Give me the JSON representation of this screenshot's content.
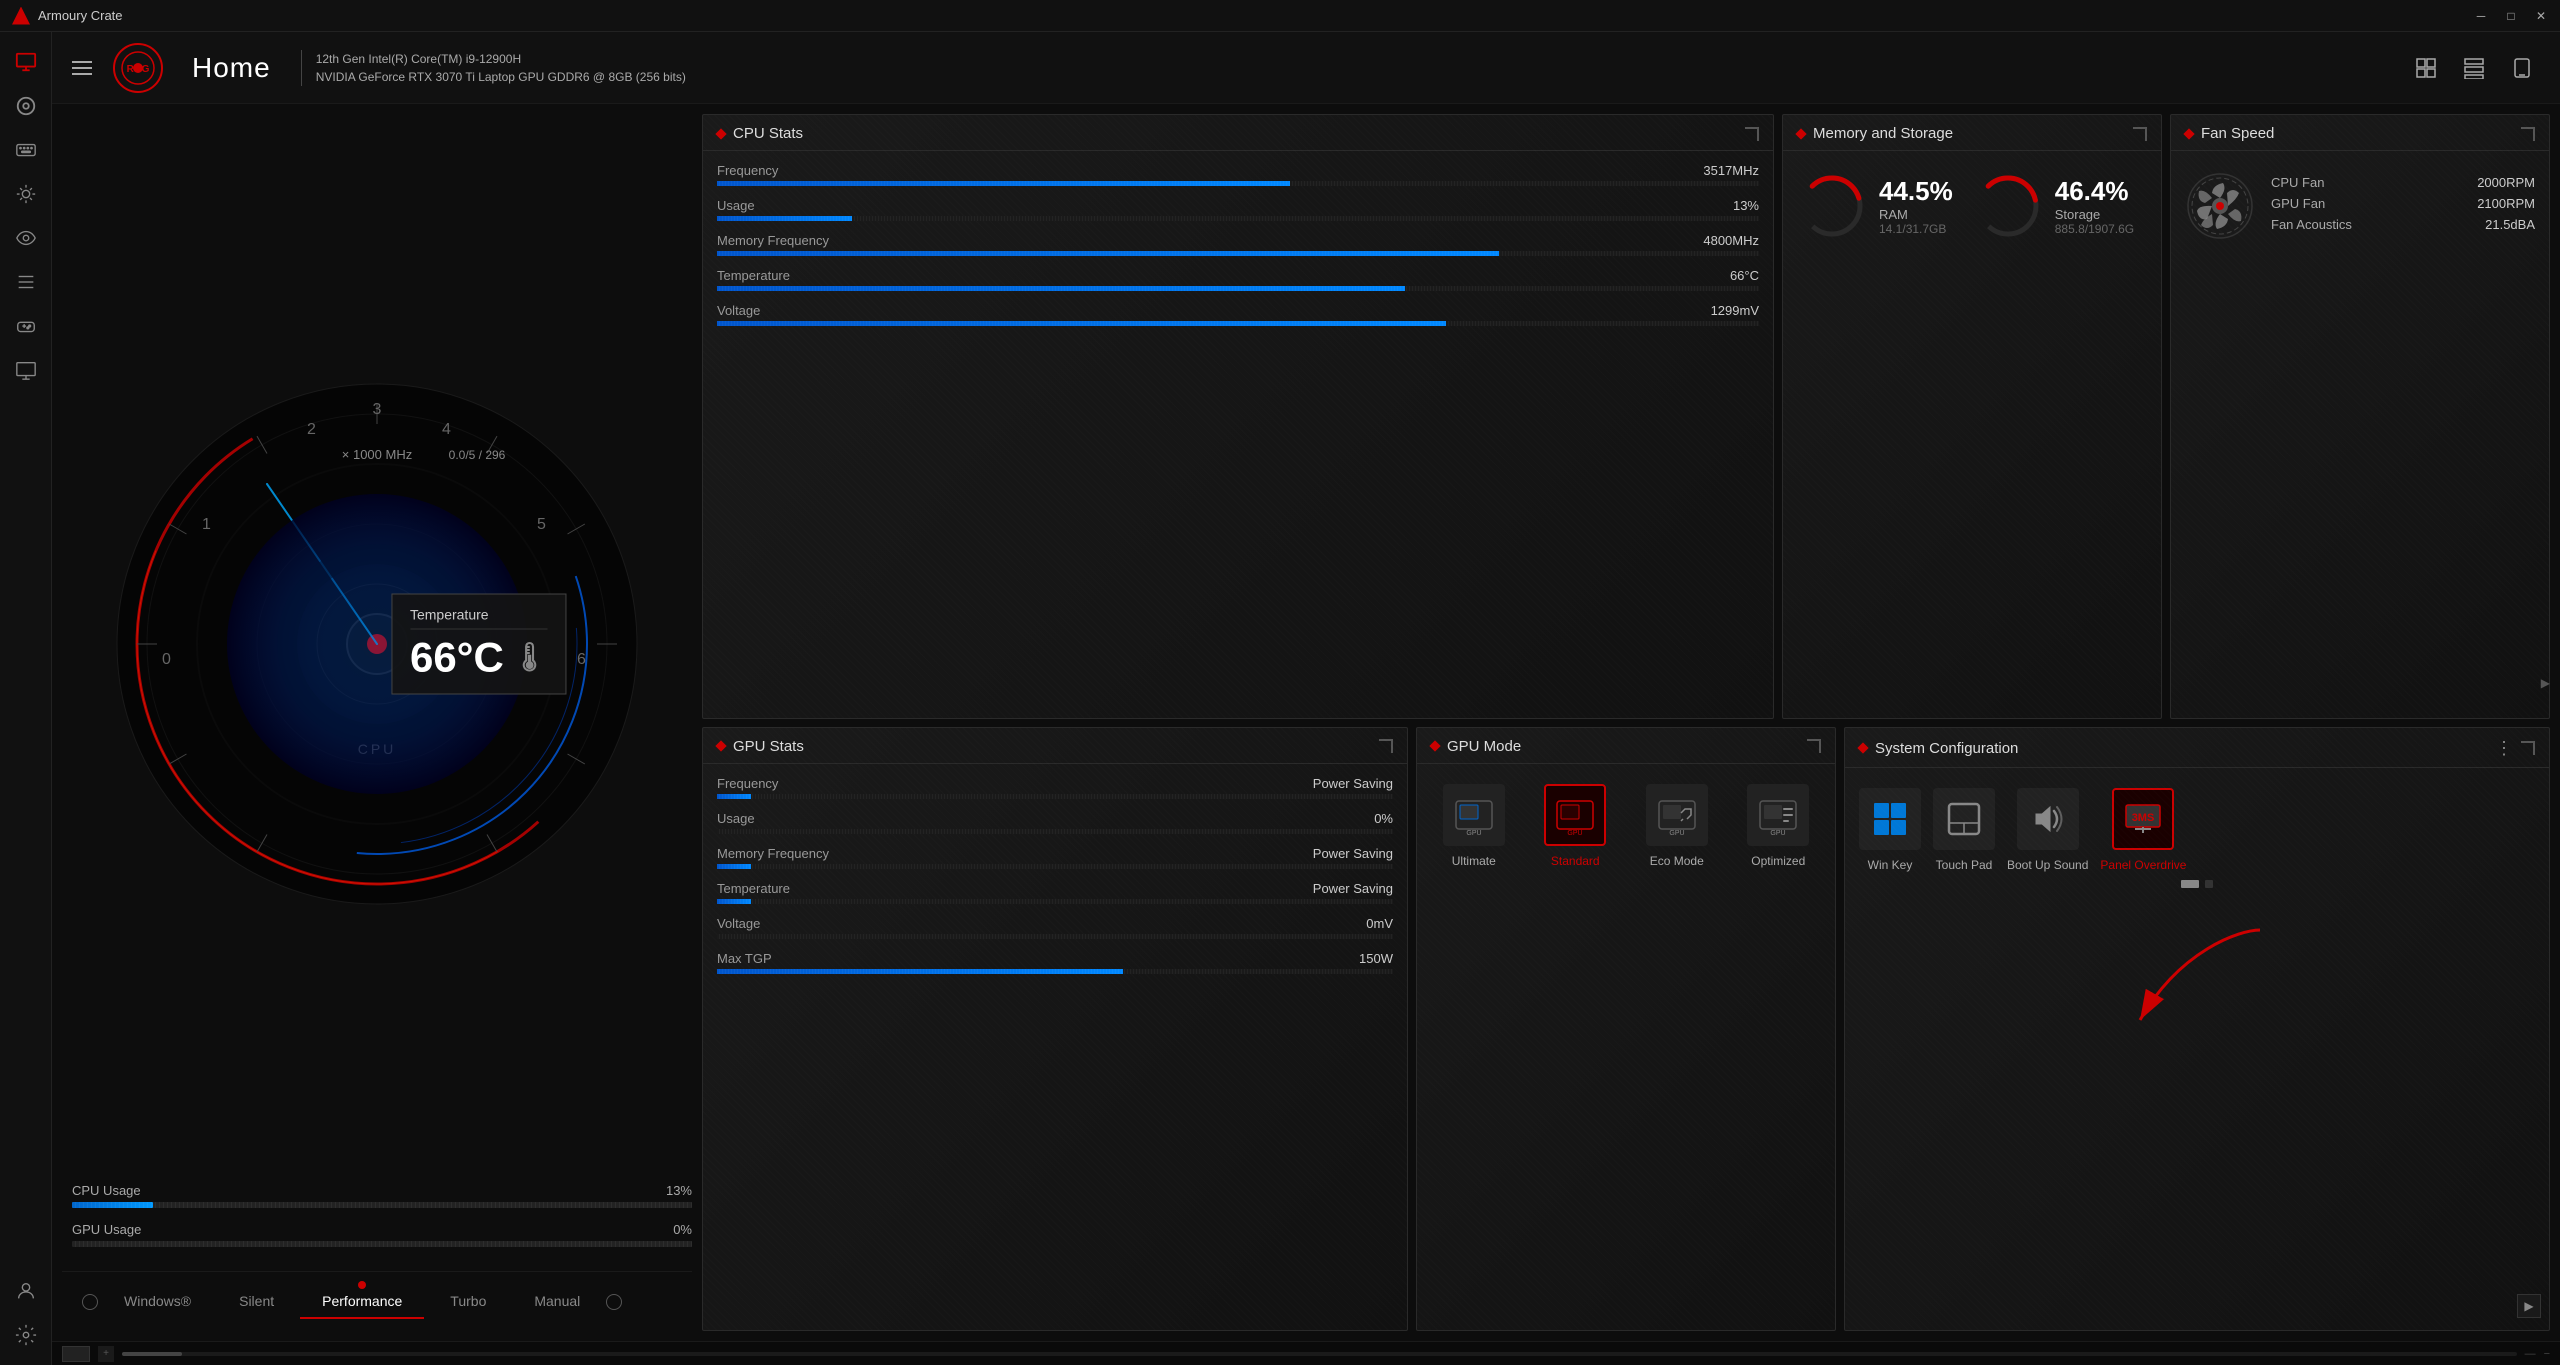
{
  "titlebar": {
    "title": "Armoury Crate",
    "minimize": "─",
    "maximize": "□",
    "close": "✕"
  },
  "header": {
    "title": "Home",
    "cpu": "12th Gen Intel(R) Core(TM) i9-12900H",
    "gpu": "NVIDIA GeForce RTX 3070 Ti Laptop GPU GDDR6 @ 8GB (256 bits)"
  },
  "sidebar": {
    "items": [
      {
        "id": "profile",
        "icon": "👤"
      },
      {
        "id": "settings-mini",
        "icon": "⊙"
      },
      {
        "id": "keyboard",
        "icon": "⌨"
      },
      {
        "id": "aura",
        "icon": "🔆"
      },
      {
        "id": "gamepad",
        "icon": "🎮"
      },
      {
        "id": "tools",
        "icon": "⚙"
      },
      {
        "id": "display",
        "icon": "🖥"
      },
      {
        "id": "network",
        "icon": "📡"
      },
      {
        "id": "settings",
        "icon": "⚙"
      }
    ]
  },
  "gauge": {
    "cpu_label": "CPU",
    "scale_label": "× 1000 MHz",
    "temperature": "66",
    "temp_unit": "°C",
    "temp_display": "66°C",
    "temp_section_label": "Temperature"
  },
  "usage_bars": {
    "cpu": {
      "label": "CPU Usage",
      "value": "13%",
      "fill_pct": 13
    },
    "gpu": {
      "label": "GPU Usage",
      "value": "0%",
      "fill_pct": 0
    }
  },
  "tabs": {
    "items": [
      {
        "id": "windows",
        "label": "Windows®"
      },
      {
        "id": "silent",
        "label": "Silent"
      },
      {
        "id": "performance",
        "label": "Performance",
        "active": true
      },
      {
        "id": "turbo",
        "label": "Turbo"
      },
      {
        "id": "manual",
        "label": "Manual"
      }
    ]
  },
  "cpu_stats": {
    "title": "CPU Stats",
    "rows": [
      {
        "label": "Frequency",
        "value": "3517MHz",
        "bar_pct": 55
      },
      {
        "label": "Usage",
        "value": "13%",
        "bar_pct": 13
      },
      {
        "label": "Memory Frequency",
        "value": "4800MHz",
        "bar_pct": 75
      },
      {
        "label": "Temperature",
        "value": "66°C",
        "bar_pct": 66
      },
      {
        "label": "Voltage",
        "value": "1299mV",
        "bar_pct": 70
      }
    ]
  },
  "memory_storage": {
    "title": "Memory and Storage",
    "ram": {
      "label": "RAM",
      "pct": "44.5%",
      "pct_num": 44.5,
      "detail": "14.1/31.7GB"
    },
    "storage": {
      "label": "Storage",
      "pct": "46.4%",
      "pct_num": 46.4,
      "detail": "885.8/1907.6G"
    }
  },
  "fan_speed": {
    "title": "Fan Speed",
    "cpu_fan": "2000RPM",
    "gpu_fan": "2100RPM",
    "fan_acoustics": "21.5dBA"
  },
  "gpu_stats": {
    "title": "GPU Stats",
    "rows": [
      {
        "label": "Frequency",
        "value": "Power Saving",
        "bar_pct": 5
      },
      {
        "label": "Usage",
        "value": "0%",
        "bar_pct": 0
      },
      {
        "label": "Memory Frequency",
        "value": "Power Saving",
        "bar_pct": 5
      },
      {
        "label": "Temperature",
        "value": "Power Saving",
        "bar_pct": 5
      },
      {
        "label": "Voltage",
        "value": "0mV",
        "bar_pct": 0
      },
      {
        "label": "Max TGP",
        "value": "150W",
        "bar_pct": 60
      }
    ]
  },
  "gpu_mode": {
    "title": "GPU Mode",
    "modes": [
      {
        "id": "ultimate",
        "label": "Ultimate",
        "active": false
      },
      {
        "id": "standard",
        "label": "Standard",
        "active": true
      },
      {
        "id": "eco",
        "label": "Eco Mode",
        "active": false
      },
      {
        "id": "optimized",
        "label": "Optimized",
        "active": false
      }
    ]
  },
  "system_config": {
    "title": "System Configuration",
    "items": [
      {
        "id": "win-key",
        "label": "Win Key",
        "selected": false,
        "icon": "⊞"
      },
      {
        "id": "touch-pad",
        "label": "Touch Pad",
        "selected": false,
        "icon": "⬜"
      },
      {
        "id": "boot-sound",
        "label": "Boot Up Sound",
        "selected": false,
        "icon": "🔊"
      },
      {
        "id": "panel-overdrive",
        "label": "Panel Overdrive",
        "selected": true,
        "icon": "📊"
      }
    ]
  }
}
